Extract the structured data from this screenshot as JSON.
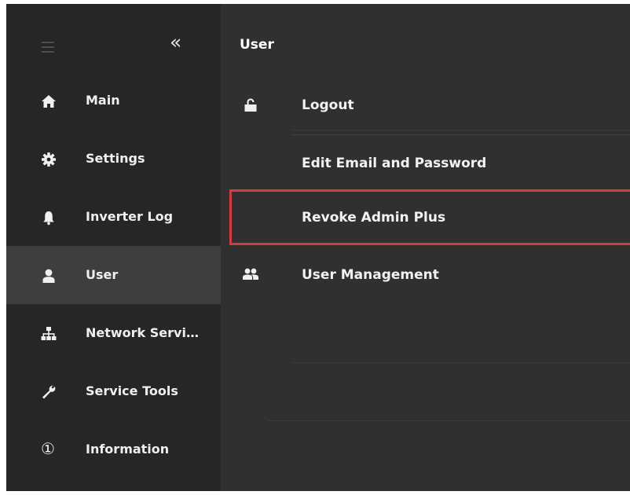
{
  "sidebar": {
    "collapse_glyph": "«",
    "items": [
      {
        "label": "Main",
        "icon": "home-icon",
        "active": false
      },
      {
        "label": "Settings",
        "icon": "gear-icon",
        "active": false
      },
      {
        "label": "Inverter Log",
        "icon": "bell-icon",
        "active": false
      },
      {
        "label": "User",
        "icon": "user-icon",
        "active": true
      },
      {
        "label": "Network Servi…",
        "icon": "network-icon",
        "active": false
      },
      {
        "label": "Service Tools",
        "icon": "wrench-icon",
        "active": false
      },
      {
        "label": "Information",
        "icon": "info-circle-icon",
        "active": false
      }
    ],
    "info_glyph": "①"
  },
  "panel": {
    "title": "User",
    "items": [
      {
        "label": "Logout",
        "icon": "lock-icon"
      },
      {
        "label": "Edit Email and Password",
        "icon": ""
      },
      {
        "label": "Revoke Admin Plus",
        "icon": "",
        "highlighted": true
      },
      {
        "label": "User Management",
        "icon": "users-icon"
      }
    ]
  },
  "colors": {
    "sidebar_bg": "#262626",
    "sidebar_active": "#3e3e3e",
    "panel_bg": "#303030",
    "highlight_border": "#d63a3f",
    "text": "#efefef"
  }
}
